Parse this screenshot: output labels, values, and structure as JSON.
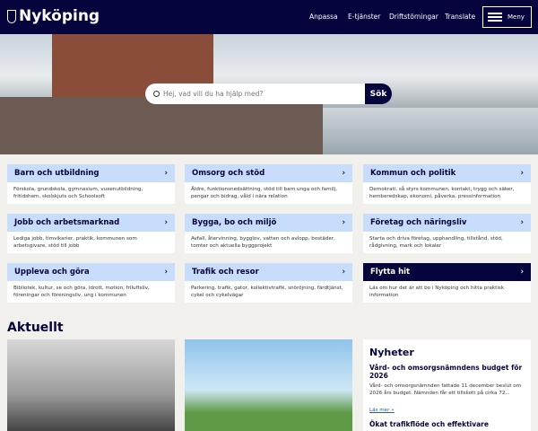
{
  "header": {
    "logo": "Nyköping",
    "nav": [
      "Anpassa",
      "E-tjänster",
      "Driftstörningar",
      "Translate"
    ],
    "menu": "Meny"
  },
  "search": {
    "placeholder": "Hej, vad vill du ha hjälp med?",
    "button": "Sök"
  },
  "cards": [
    {
      "title": "Barn och utbildning",
      "desc": "Förskola, grundskola, gymnasium, vuxenutbildning, fritidshem, skolskjuts och Schoolsoft"
    },
    {
      "title": "Omsorg och stöd",
      "desc": "Äldre, funktionsnedsättning, stöd till barn unga och familj, pengar och bidrag, våld i nära relation"
    },
    {
      "title": "Kommun och politik",
      "desc": "Demokrati, så styrs kommunen, kontakt, trygg och säker, hemberedskap, ekonomi, påverka, pressinformation"
    },
    {
      "title": "Jobb och arbetsmarknad",
      "desc": "Lediga jobb, timvikarier, praktik, kommunen som arbetsgivare, stöd till jobb"
    },
    {
      "title": "Bygga, bo och miljö",
      "desc": "Avfall, återvinning, bygglov, vatten och avlopp, bostäder, tomter och aktuella byggprojekt"
    },
    {
      "title": "Företag och näringsliv",
      "desc": "Starta och driva företag, upphandling, tillstånd, stöd, rådgivning, mark och lokaler"
    },
    {
      "title": "Uppleva och göra",
      "desc": "Bibliotek, kultur, se och göra, idrott, motion, friluftsliv, föreningar och föreningsliv, ung i kommunen"
    },
    {
      "title": "Trafik och resor",
      "desc": "Parkering, trafik, gator, kollektivtrafik, snöröjning, färdtjänst, cykel och cykelvägar"
    },
    {
      "title": "Flytta hit",
      "desc": "Läs om hur det är att bo i Nyköping och hitta praktisk information"
    }
  ],
  "aktuellt": {
    "heading": "Aktuellt"
  },
  "news": {
    "heading": "Nyheter",
    "items": [
      {
        "title": "Vård- och omsorgsnämndens budget för 2026",
        "text": "Vård- och omsorgsnämnden fattade 11 december beslut om 2026 års budget. Nämnden får ett tillskott på cirka 72...",
        "link": "Läs mer"
      },
      {
        "title": "Ökat trafikflöde och effektivare"
      }
    ]
  }
}
